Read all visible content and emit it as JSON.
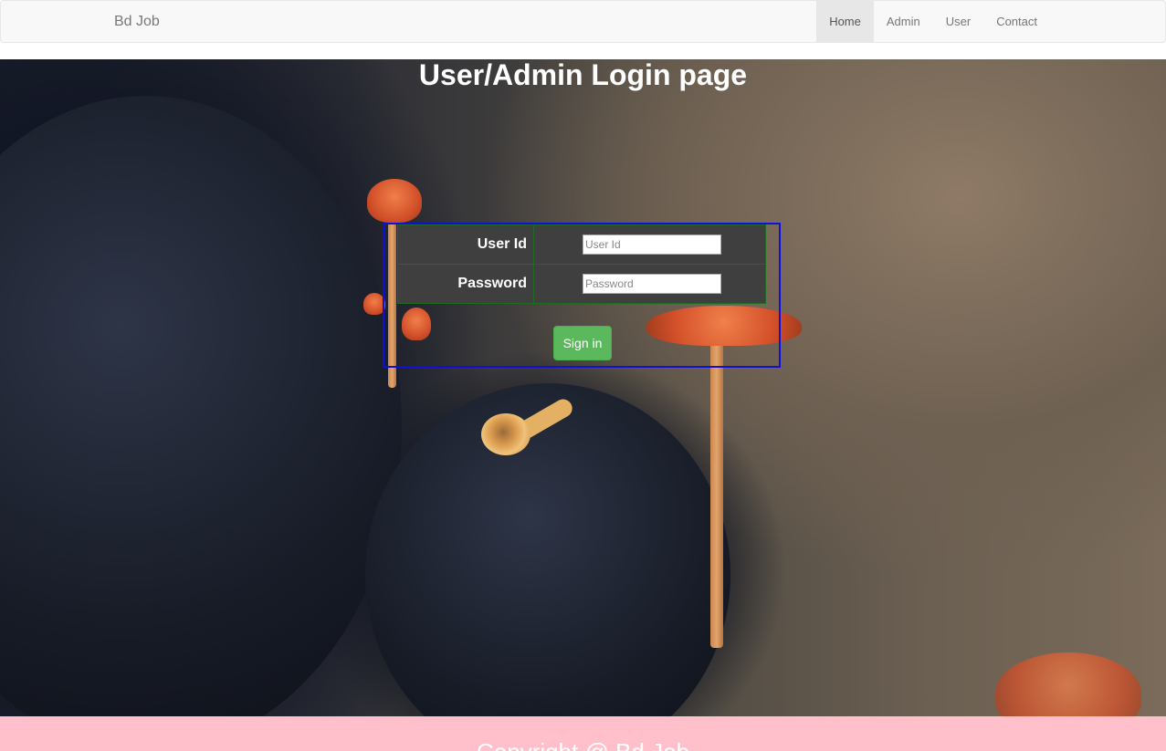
{
  "navbar": {
    "brand": "Bd Job",
    "items": [
      {
        "label": "Home",
        "active": true
      },
      {
        "label": "Admin",
        "active": false
      },
      {
        "label": "User",
        "active": false
      },
      {
        "label": "Contact",
        "active": false
      }
    ]
  },
  "main": {
    "title": "User/Admin Login page",
    "form": {
      "user_id_label": "User Id",
      "user_id_placeholder": "User Id",
      "password_label": "Password",
      "password_placeholder": "Password",
      "submit_label": "Sign in"
    }
  },
  "footer": {
    "text": "Copyright @ Bd Job"
  },
  "colors": {
    "navbar_bg": "#f8f8f8",
    "active_nav_bg": "#e7e7e7",
    "form_border": "#1010d8",
    "form_bg": "#3f3f3f",
    "button": "#5cb85c",
    "footer_bg": "#ffc0cb"
  }
}
